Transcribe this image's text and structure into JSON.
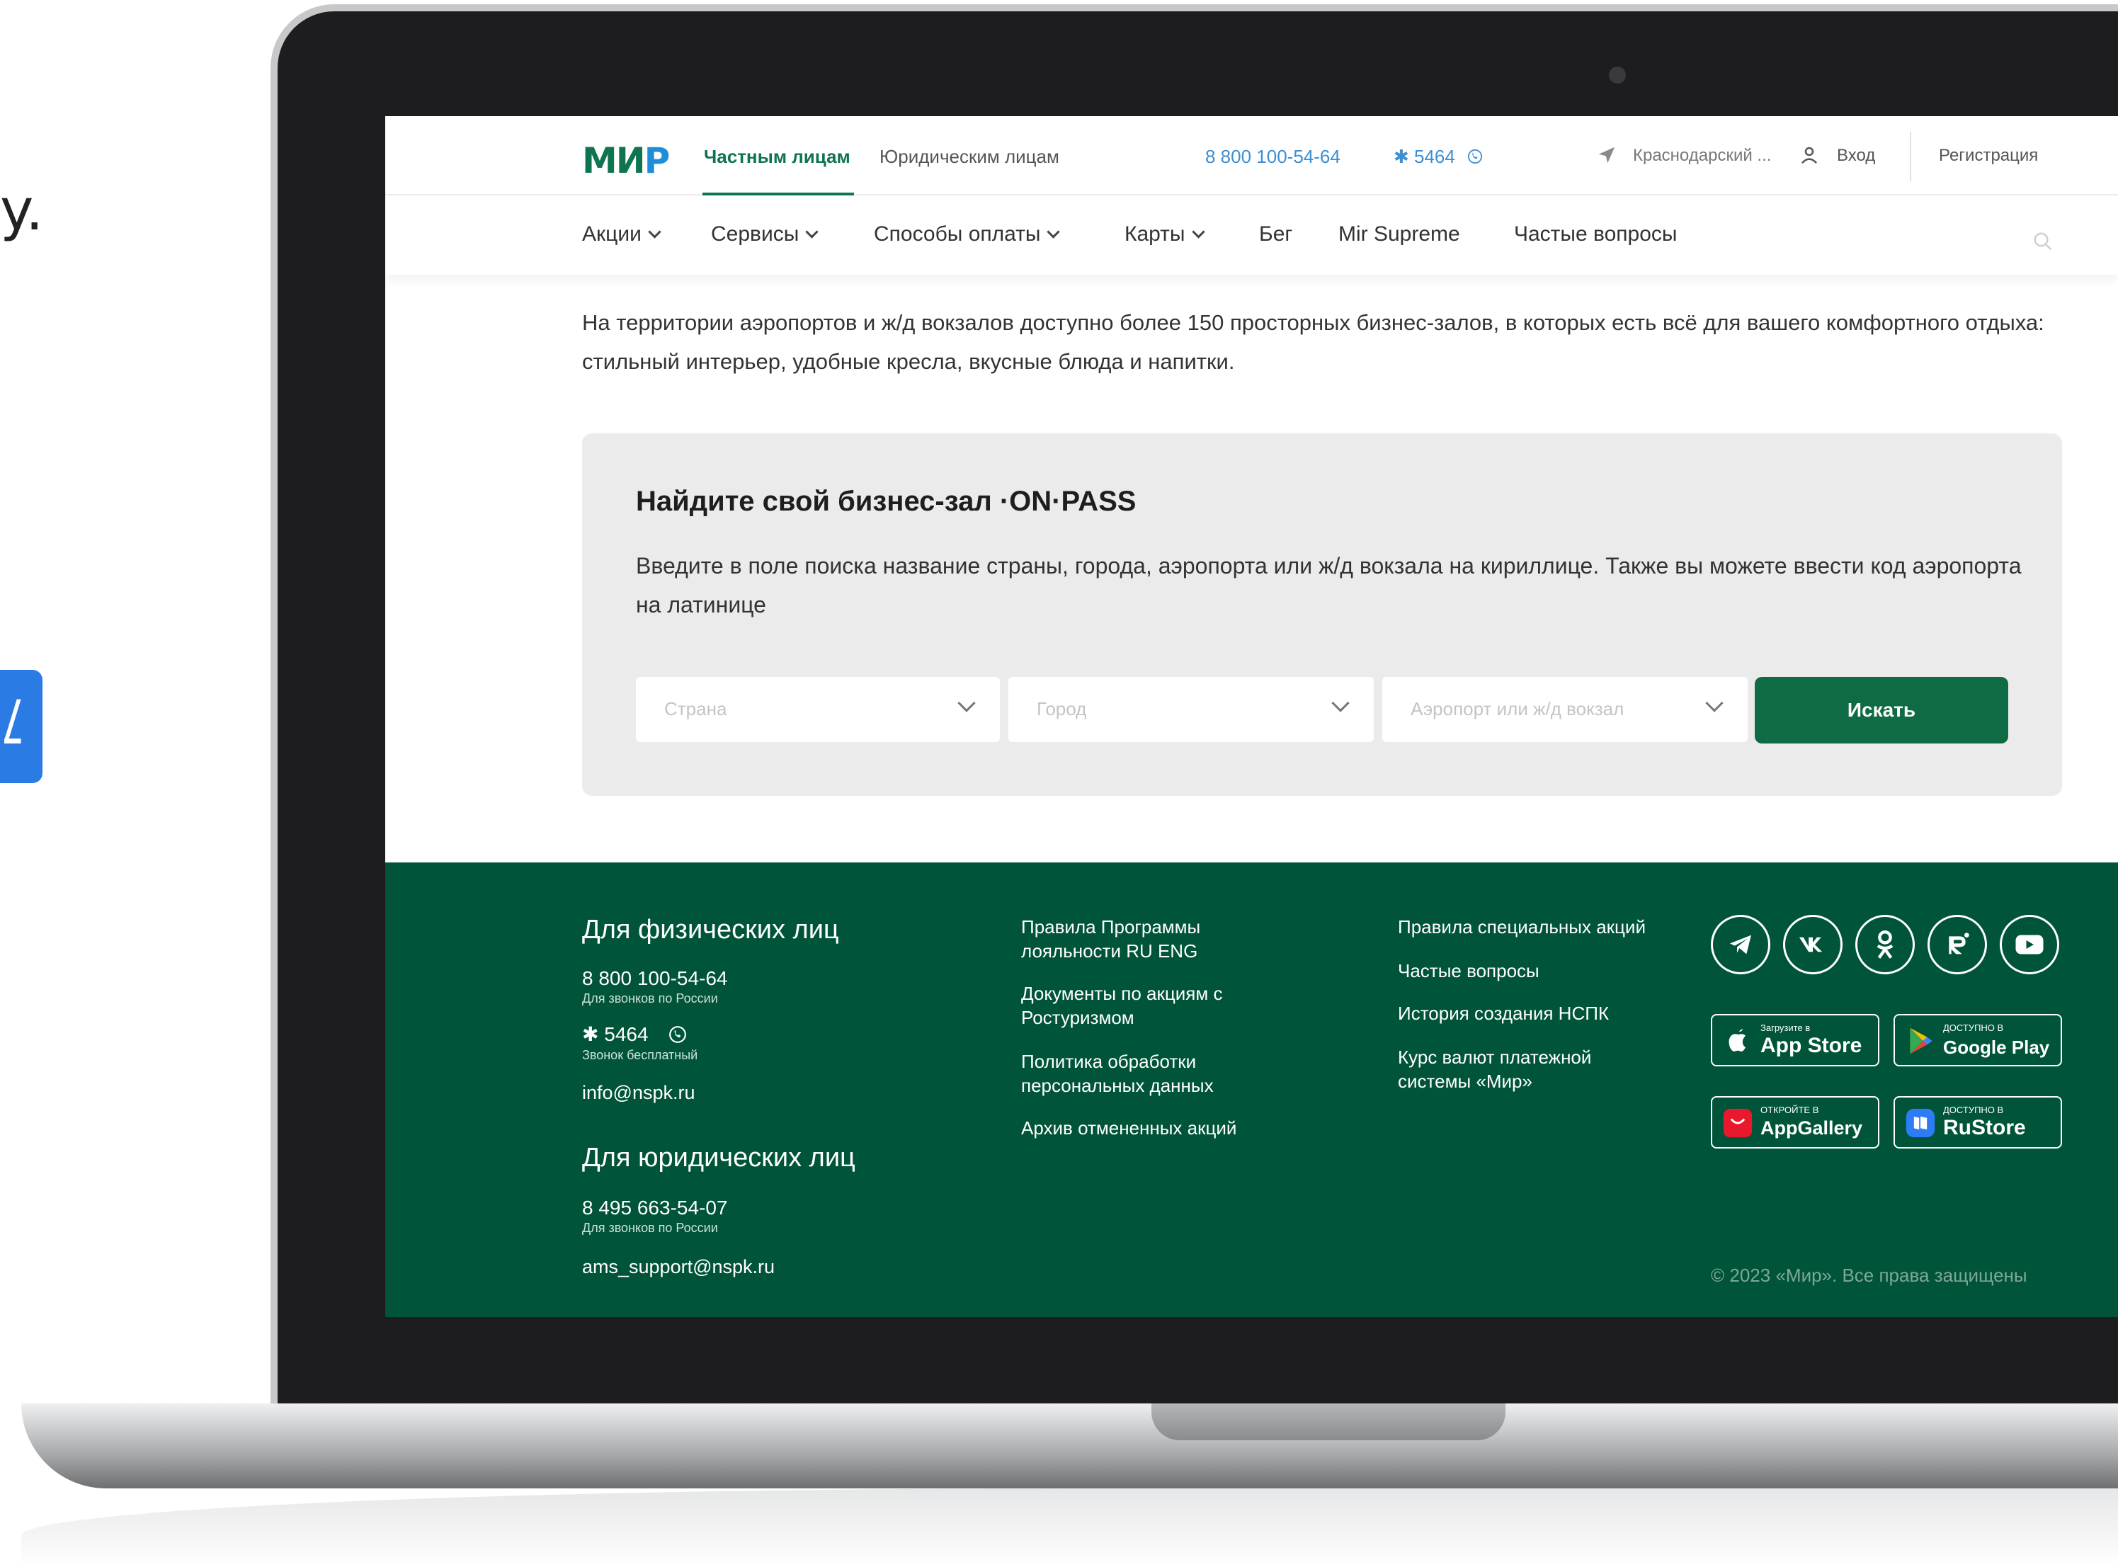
{
  "slide": {
    "fragment": "y.",
    "blue_tab_text": "/"
  },
  "header": {
    "logo_main": "МИ",
    "logo_accent": "Р",
    "tabs": [
      {
        "label": "Частным лицам"
      },
      {
        "label": "Юридическим лицам"
      }
    ],
    "phone": "8 800 100-54-64",
    "short_number": "✱ 5464",
    "region": "Краснодарский ...",
    "login": "Вход",
    "register": "Регистрация"
  },
  "menu": {
    "items": [
      {
        "label": "Акции"
      },
      {
        "label": "Сервисы"
      },
      {
        "label": "Способы оплаты"
      },
      {
        "label": "Карты"
      },
      {
        "label": "Бег"
      },
      {
        "label": "Mir Supreme"
      },
      {
        "label": "Частые вопросы"
      }
    ]
  },
  "intro": "На территории аэропортов и ж/д вокзалов доступно более 150 просторных бизнес-залов, в которых есть всё для вашего комфортного отдыха: стильный интерьер, удобные кресла, вкусные блюда и напитки.",
  "finder": {
    "title": "Найдите свой бизнес-зал ·ON·PASS",
    "description": "Введите в поле поиска название страны, города, аэропорта или ж/д вокзала на кириллице. Также вы можете ввести код аэропорта на латинице",
    "country_placeholder": "Страна",
    "city_placeholder": "Город",
    "airport_placeholder": "Аэропорт или ж/д вокзал",
    "search_label": "Искать"
  },
  "footer": {
    "individuals": {
      "heading": "Для физических лиц",
      "phone": "8 800 100-54-64",
      "phone_note": "Для звонков по России",
      "short": "✱ 5464",
      "short_note": "Звонок бесплатный",
      "email": "info@nspk.ru"
    },
    "legal": {
      "heading": "Для юридических лиц",
      "phone": "8 495 663-54-07",
      "phone_note": "Для звонков по России",
      "email": "ams_support@nspk.ru"
    },
    "links_col1": [
      "Правила Программы лояльности RU ENG",
      "Документы по акциям с Ростуризмом",
      "Политика обработки персональных данных",
      "Архив отмененных акций"
    ],
    "links_col2": [
      "Правила специальных акций",
      "Частые вопросы",
      "История создания НСПК",
      "Курс валют платежной системы «Мир»"
    ],
    "social_icons": [
      "telegram-icon",
      "vk-icon",
      "odnoklassniki-icon",
      "rutube-icon",
      "youtube-icon"
    ],
    "stores": [
      {
        "small": "Загрузите в",
        "big": "App Store"
      },
      {
        "small": "ДОСТУПНО В",
        "big": "Google Play"
      },
      {
        "small": "ОТКРОЙТЕ В",
        "big": "AppGallery"
      },
      {
        "small": "ДОСТУПНО В",
        "big": "RuStore"
      }
    ],
    "copyright": "© 2023 «Мир». Все права защищены"
  },
  "colors": {
    "brand_green": "#0f754e",
    "footer_green": "#005439",
    "accent_blue": "#1e8fd6",
    "link_blue": "#3e8fd1"
  }
}
